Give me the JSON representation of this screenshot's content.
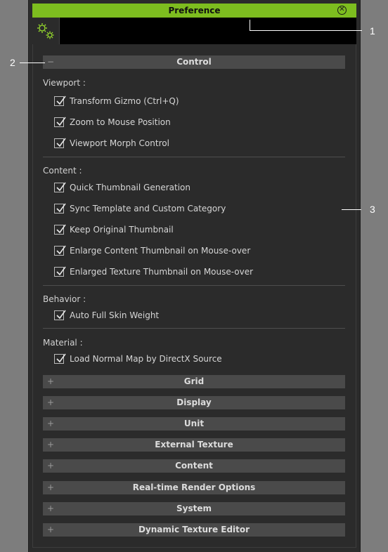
{
  "window": {
    "title": "Preference",
    "close_glyph": "✕"
  },
  "tabs": [
    {
      "icon": "gears-icon"
    }
  ],
  "sections": {
    "control": {
      "sign": "−",
      "label": "Control"
    },
    "grid": {
      "sign": "+",
      "label": "Grid"
    },
    "display": {
      "sign": "+",
      "label": "Display"
    },
    "unit": {
      "sign": "+",
      "label": "Unit"
    },
    "external_texture": {
      "sign": "+",
      "label": "External Texture"
    },
    "content": {
      "sign": "+",
      "label": "Content"
    },
    "realtime_render": {
      "sign": "+",
      "label": "Real-time Render Options"
    },
    "system": {
      "sign": "+",
      "label": "System"
    },
    "dynamic_texture": {
      "sign": "+",
      "label": "Dynamic Texture Editor"
    }
  },
  "control": {
    "viewport": {
      "label": "Viewport :",
      "options": [
        {
          "label": "Transform Gizmo (Ctrl+Q)",
          "checked": true
        },
        {
          "label": "Zoom to Mouse Position",
          "checked": true
        },
        {
          "label": "Viewport Morph Control",
          "checked": true
        }
      ]
    },
    "content": {
      "label": "Content :",
      "options": [
        {
          "label": "Quick Thumbnail Generation",
          "checked": true
        },
        {
          "label": "Sync Template and Custom Category",
          "checked": true
        },
        {
          "label": "Keep Original Thumbnail",
          "checked": true
        },
        {
          "label": "Enlarge Content Thumbnail on Mouse-over",
          "checked": true
        },
        {
          "label": "Enlarged Texture Thumbnail on Mouse-over",
          "checked": true
        }
      ]
    },
    "behavior": {
      "label": "Behavior :",
      "options": [
        {
          "label": "Auto Full Skin Weight",
          "checked": true
        }
      ]
    },
    "material": {
      "label": "Material :",
      "options": [
        {
          "label": "Load Normal Map by DirectX Source",
          "checked": true
        }
      ]
    }
  },
  "callouts": {
    "one": "1",
    "two": "2",
    "three": "3"
  },
  "colors": {
    "title_bar": "#7dbd1f",
    "panel_bg": "#2b2b2b",
    "section_bar": "#4a4a4a",
    "page_bg": "#7d7d7d"
  }
}
